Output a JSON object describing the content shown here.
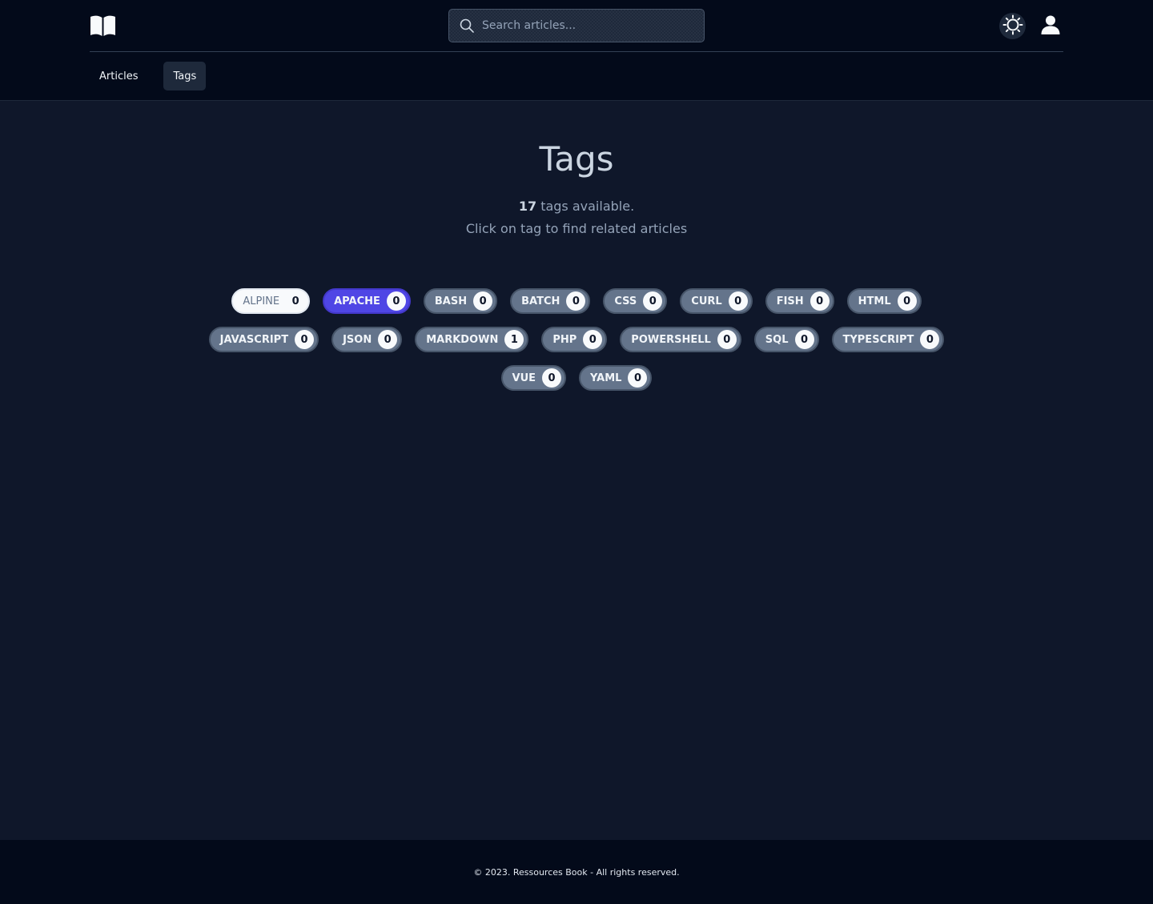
{
  "header": {
    "logo_icon": "open-book-icon",
    "search": {
      "placeholder": "Search articles...",
      "value": ""
    },
    "theme_icon": "sun-icon",
    "user_icon": "user-icon"
  },
  "nav": {
    "items": [
      {
        "label": "Articles",
        "active": false
      },
      {
        "label": "Tags",
        "active": true
      }
    ]
  },
  "main": {
    "title": "Tags",
    "count": "17",
    "count_suffix": " tags available.",
    "hint": "Click on tag to find related articles"
  },
  "tags": [
    {
      "name": "ALPINE",
      "count": "0",
      "style": "light"
    },
    {
      "name": "APACHE",
      "count": "0",
      "style": "accent"
    },
    {
      "name": "BASH",
      "count": "0",
      "style": "default"
    },
    {
      "name": "BATCH",
      "count": "0",
      "style": "default"
    },
    {
      "name": "CSS",
      "count": "0",
      "style": "default"
    },
    {
      "name": "CURL",
      "count": "0",
      "style": "default"
    },
    {
      "name": "FISH",
      "count": "0",
      "style": "default"
    },
    {
      "name": "HTML",
      "count": "0",
      "style": "default"
    },
    {
      "name": "JAVASCRIPT",
      "count": "0",
      "style": "default"
    },
    {
      "name": "JSON",
      "count": "0",
      "style": "default"
    },
    {
      "name": "MARKDOWN",
      "count": "1",
      "style": "default"
    },
    {
      "name": "PHP",
      "count": "0",
      "style": "default"
    },
    {
      "name": "POWERSHELL",
      "count": "0",
      "style": "default"
    },
    {
      "name": "SQL",
      "count": "0",
      "style": "default"
    },
    {
      "name": "TYPESCRIPT",
      "count": "0",
      "style": "default"
    },
    {
      "name": "VUE",
      "count": "0",
      "style": "default"
    },
    {
      "name": "YAML",
      "count": "0",
      "style": "default"
    }
  ],
  "footer": {
    "text": "© 2023. Ressources Book - All rights reserved."
  },
  "colors": {
    "background": "#0f172a",
    "header_bg": "#030a1a",
    "accent": "#4f46e5",
    "tag_bg": "#64748b"
  }
}
